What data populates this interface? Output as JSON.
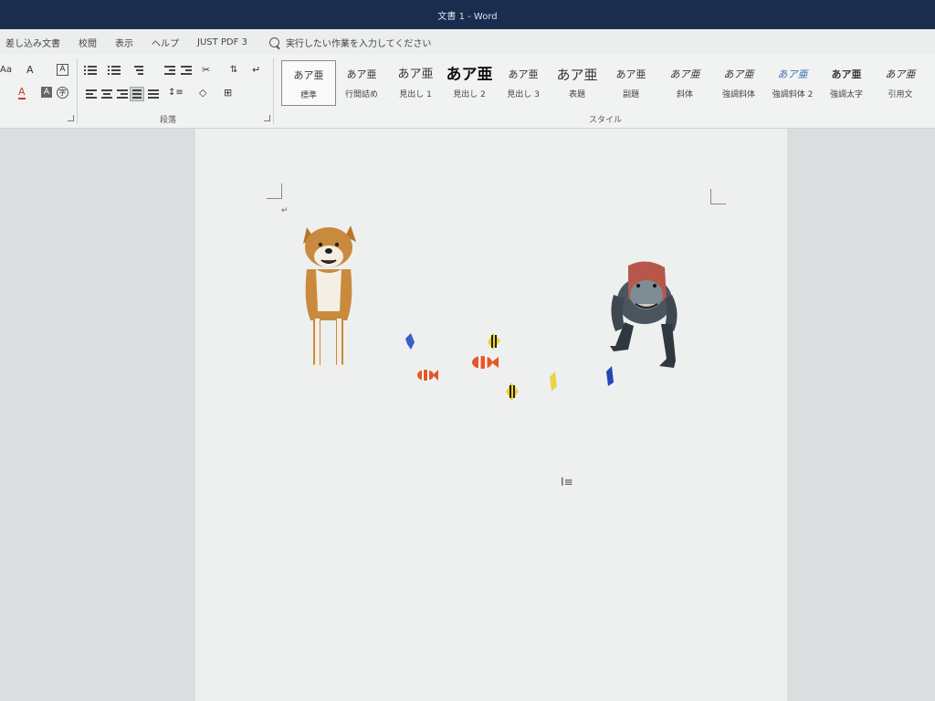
{
  "window": {
    "title": "文書 1 - Word"
  },
  "menu": {
    "tabs": [
      "差し込み文書",
      "校閲",
      "表示",
      "ヘルプ",
      "JUST PDF 3"
    ],
    "tell_me_placeholder": "実行したい作業を入力してください"
  },
  "ribbon": {
    "font_group": {
      "change_case": "Aa",
      "clear_format": "A",
      "char_border": "A",
      "font_color": "A",
      "char_shading": "A",
      "enclosed_char": "字"
    },
    "paragraph_group_label": "段落",
    "styles_group_label": "スタイル",
    "styles": [
      {
        "preview": "あア亜",
        "name": "標準",
        "selected": true
      },
      {
        "preview": "あア亜",
        "name": "行間詰め"
      },
      {
        "preview": "あア亜",
        "name": "見出し 1"
      },
      {
        "preview": "あア亜",
        "name": "見出し 2"
      },
      {
        "preview": "あア亜",
        "name": "見出し 3"
      },
      {
        "preview": "あア亜",
        "name": "表題"
      },
      {
        "preview": "あア亜",
        "name": "副題"
      },
      {
        "preview": "あア亜",
        "name": "斜体"
      },
      {
        "preview": "あア亜",
        "name": "強調斜体"
      },
      {
        "preview": "あア亜",
        "name": "強調斜体 2"
      },
      {
        "preview": "あア亜",
        "name": "強調太字"
      },
      {
        "preview": "あア亜",
        "name": "引用文"
      }
    ]
  },
  "document": {
    "paragraph_mark": "↵",
    "objects": [
      "shiba-inu-dog",
      "tropical-fish",
      "t-rex-dinosaur"
    ]
  },
  "colors": {
    "titlebar": "#1a2d4e",
    "ribbon": "#f1f2f2",
    "page": "#eef0ef",
    "font_color_red": "#d23a2a"
  }
}
